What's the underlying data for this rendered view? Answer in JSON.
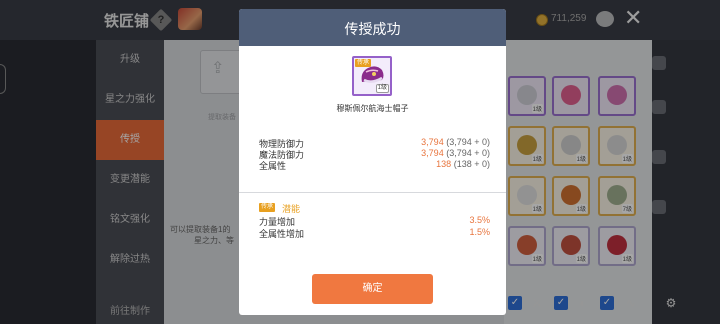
{
  "background": {
    "title": "铁匠铺",
    "help_glyph": "?",
    "money": "711,259",
    "close_glyph": "✕",
    "sidebar": [
      {
        "label": "升级"
      },
      {
        "label": "星之力强化"
      },
      {
        "label": "传授",
        "active": true
      },
      {
        "label": "变更潜能"
      },
      {
        "label": "铭文强化"
      },
      {
        "label": "解除过热"
      },
      {
        "label": "前往制作"
      }
    ],
    "slot_text": "提取装备",
    "hint": [
      "可以提取装备1的",
      "星之力、等"
    ],
    "colors": {
      "accent": "#e86a3a",
      "sidebar": "#4a4d55"
    }
  },
  "dialog": {
    "title": "传授成功",
    "item": {
      "name": "穆斯佩尔航海士帽子",
      "tag": "传承",
      "level": "1级",
      "icon": "hat-icon"
    },
    "stats": [
      {
        "label": "物理防御力",
        "value": "3,794",
        "detail": "(3,794 + 0)"
      },
      {
        "label": "魔法防御力",
        "value": "3,794",
        "detail": "(3,794 + 0)"
      },
      {
        "label": "全属性",
        "value": "138",
        "detail": "(138 + 0)"
      }
    ],
    "potential": {
      "tag": "传承",
      "label": "潜能",
      "rows": [
        {
          "label": "力量增加",
          "value": "3.5%"
        },
        {
          "label": "全属性增加",
          "value": "1.5%"
        }
      ]
    },
    "confirm_label": "确定",
    "colors": {
      "header": "#4f5e78",
      "button": "#f07840",
      "value": "#e8753e",
      "potential": "#e8a020"
    }
  }
}
